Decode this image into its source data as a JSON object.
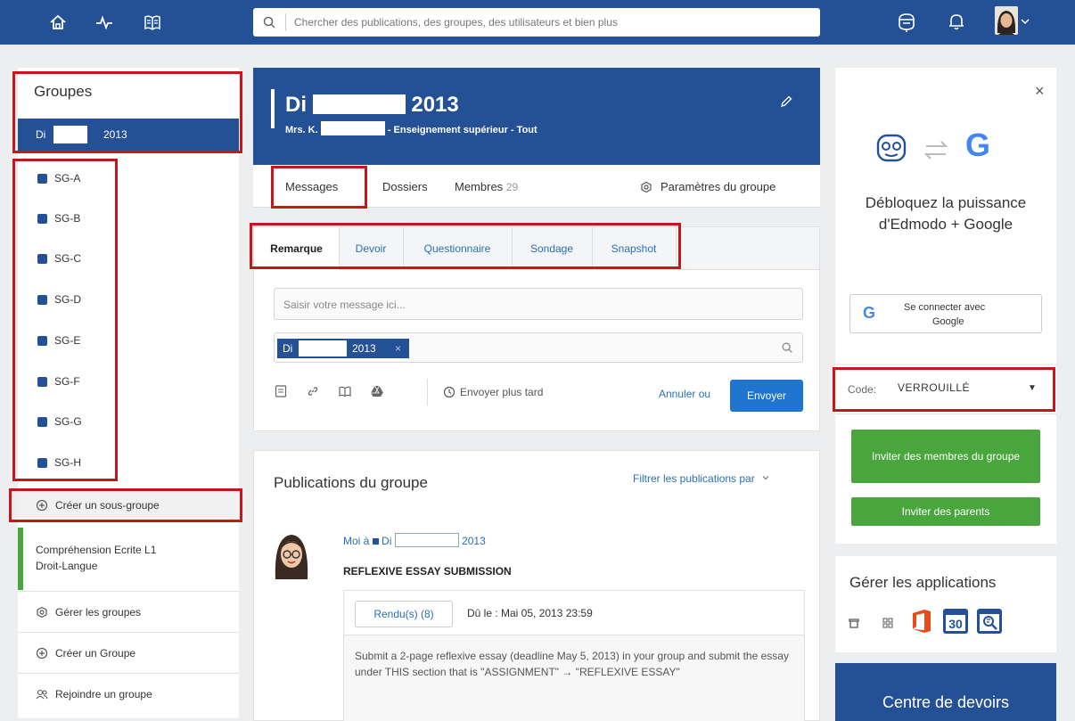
{
  "search": {
    "placeholder": "Chercher des publications, des groupes, des utilisateurs et bien plus"
  },
  "sidebar": {
    "title": "Groupes",
    "active_group": {
      "prefix": "Di",
      "suffix": "2013"
    },
    "subgroups": [
      "SG-A",
      "SG-B",
      "SG-C",
      "SG-D",
      "SG-E",
      "SG-F",
      "SG-G",
      "SG-H"
    ],
    "create_subgroup": "Créer un sous-groupe",
    "other_group_line1": "Compréhension Ecrite L1",
    "other_group_line2": "Droit-Langue",
    "manage_groups": "Gérer les groupes",
    "create_group": "Créer un Groupe",
    "join_group": "Rejoindre un groupe"
  },
  "group": {
    "name_prefix": "Di",
    "name_suffix": "2013",
    "sub_prefix": "Mrs. K.",
    "sub_suffix": "- Enseignement supérieur - Tout",
    "tabs": {
      "messages": "Messages",
      "folders": "Dossiers",
      "members": "Membres",
      "members_count": "29",
      "settings": "Paramètres du groupe"
    }
  },
  "composer": {
    "tabs": [
      "Remarque",
      "Devoir",
      "Questionnaire",
      "Sondage",
      "Snapshot"
    ],
    "placeholder": "Saisir votre message ici...",
    "chip_prefix": "Di",
    "chip_suffix": "2013",
    "chip_close": "×",
    "send_later": "Envoyer plus tard",
    "cancel": "Annuler ou",
    "send": "Envoyer"
  },
  "posts": {
    "title": "Publications du groupe",
    "filter": "Filtrer les publications par",
    "post": {
      "from": "Moi à",
      "to_prefix": "Di",
      "to_suffix": "2013",
      "title": "REFLEXIVE ESSAY SUBMISSION",
      "submitted": "Rendu(s) (8)",
      "due": "Dû le : Mai 05, 2013 23:59",
      "body": "Submit a 2-page reflexive essay (deadline May 5, 2013) in your group and submit the essay under THIS section that is \"ASSIGNMENT\" → \"REFLEXIVE ESSAY\""
    }
  },
  "promo": {
    "close": "×",
    "text": "Débloquez la puissance d'Edmodo + Google",
    "google_button_line1": "Se connecter avec",
    "google_button_line2": "Google",
    "google_letter": "G"
  },
  "code": {
    "label": "Code:",
    "value": "VERROUILLÉ"
  },
  "invite": {
    "members": "Inviter des membres du groupe",
    "parents": "Inviter des parents"
  },
  "apps": {
    "title": "Gérer les applications",
    "calendar_day": "30"
  },
  "homework": {
    "title": "Centre de devoirs"
  },
  "colors": {
    "brand": "#245096",
    "accent": "#1f74d0",
    "green": "#48a63c",
    "highlight": "#c4161c"
  }
}
